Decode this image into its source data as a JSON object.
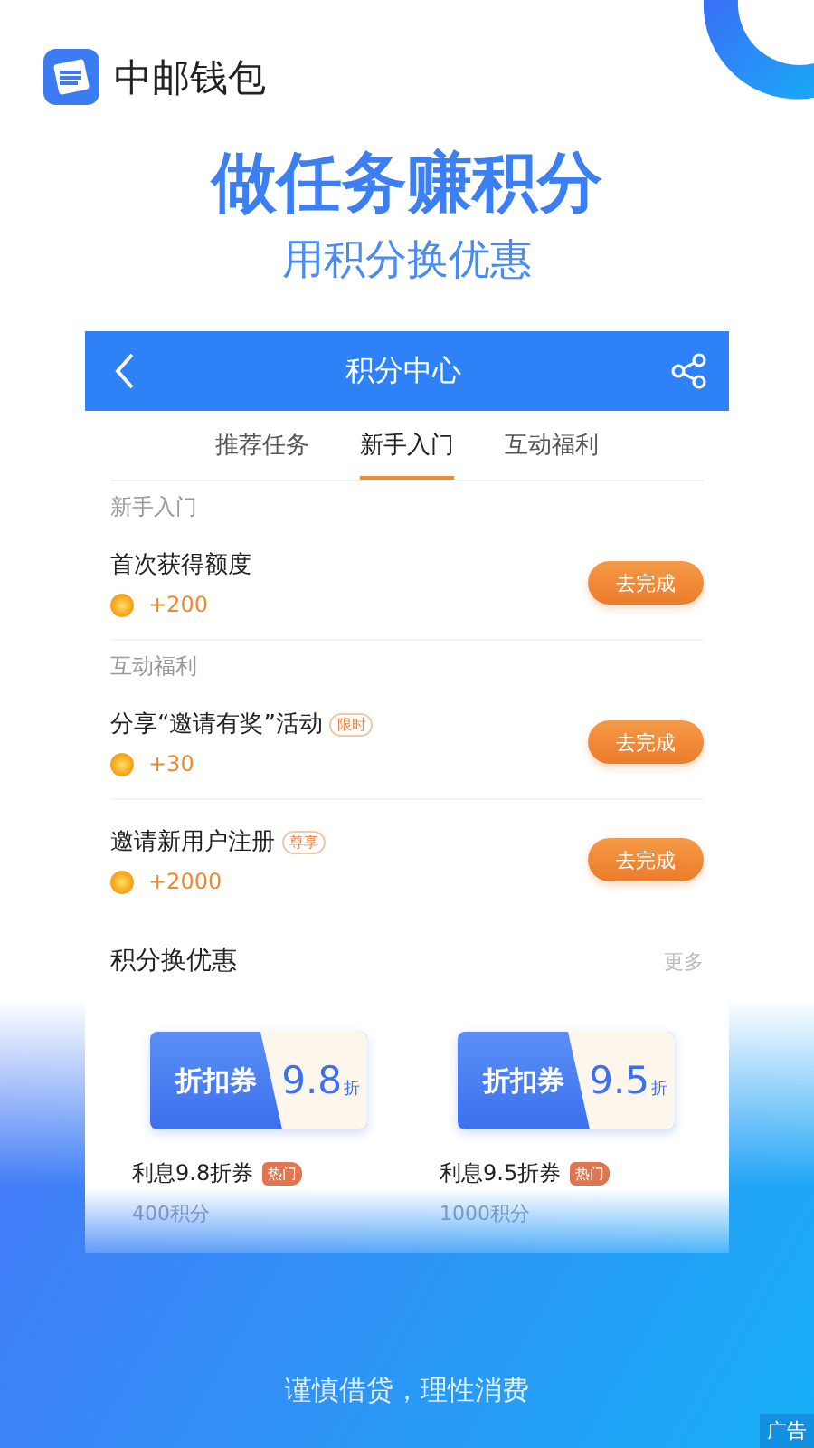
{
  "app": {
    "name": "中邮钱包"
  },
  "headline": "做任务赚积分",
  "subheadline": "用积分换优惠",
  "screen": {
    "title": "积分中心",
    "tabs": [
      {
        "label": "推荐任务",
        "selected": false
      },
      {
        "label": "新手入门",
        "selected": true
      },
      {
        "label": "互动福利",
        "selected": false
      }
    ],
    "sections": [
      {
        "title": "新手入门",
        "tasks": [
          {
            "name": "首次获得额度",
            "points": "+200",
            "button": "去完成"
          }
        ]
      },
      {
        "title": "互动福利",
        "tasks": [
          {
            "name": "分享“邀请有奖”活动",
            "tag": "限时",
            "points": "+30",
            "button": "去完成"
          },
          {
            "name": "邀请新用户注册",
            "tag": "尊享",
            "points": "+2000",
            "button": "去完成"
          }
        ]
      }
    ],
    "exchange": {
      "title": "积分换优惠",
      "more": "更多",
      "coupons": [
        {
          "label": "折扣券",
          "value": "9.8",
          "unit": "折",
          "name": "利息9.8折券",
          "tag": "热门",
          "cost": "400积分"
        },
        {
          "label": "折扣券",
          "value": "9.5",
          "unit": "折",
          "name": "利息9.5折券",
          "tag": "热门",
          "cost": "1000积分"
        }
      ]
    }
  },
  "footer": "谨慎借贷，理性消费",
  "ad_label": "广告"
}
